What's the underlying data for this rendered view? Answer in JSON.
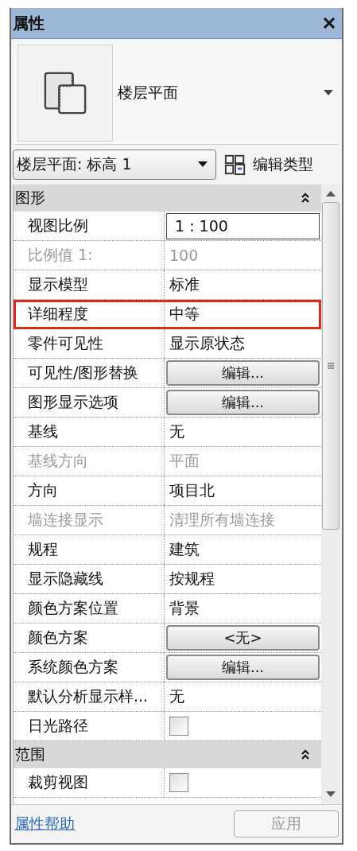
{
  "panel": {
    "title": "属性"
  },
  "type_selector": {
    "type_name": "楼层平面"
  },
  "instance_selector": {
    "value": "楼层平面: 标高 1"
  },
  "edit_type_button": {
    "label": "编辑类型"
  },
  "sections": [
    {
      "title": "图形",
      "expanded": true,
      "rows": [
        {
          "label": "视图比例",
          "kind": "input",
          "value": "1 : 100",
          "disabled": false,
          "highlighted": false
        },
        {
          "label": "比例值 1:",
          "kind": "text",
          "value": "100",
          "disabled": true,
          "highlighted": false
        },
        {
          "label": "显示模型",
          "kind": "text",
          "value": "标准",
          "disabled": false,
          "highlighted": false
        },
        {
          "label": "详细程度",
          "kind": "text",
          "value": "中等",
          "disabled": false,
          "highlighted": true
        },
        {
          "label": "零件可见性",
          "kind": "text",
          "value": "显示原状态",
          "disabled": false,
          "highlighted": false
        },
        {
          "label": "可见性/图形替换",
          "kind": "button",
          "value": "编辑...",
          "disabled": false,
          "highlighted": false
        },
        {
          "label": "图形显示选项",
          "kind": "button",
          "value": "编辑...",
          "disabled": false,
          "highlighted": false
        },
        {
          "label": "基线",
          "kind": "text",
          "value": "无",
          "disabled": false,
          "highlighted": false
        },
        {
          "label": "基线方向",
          "kind": "text",
          "value": "平面",
          "disabled": true,
          "highlighted": false
        },
        {
          "label": "方向",
          "kind": "text",
          "value": "项目北",
          "disabled": false,
          "highlighted": false
        },
        {
          "label": "墙连接显示",
          "kind": "text",
          "value": "清理所有墙连接",
          "disabled": true,
          "highlighted": false
        },
        {
          "label": "规程",
          "kind": "text",
          "value": "建筑",
          "disabled": false,
          "highlighted": false
        },
        {
          "label": "显示隐藏线",
          "kind": "text",
          "value": "按规程",
          "disabled": false,
          "highlighted": false
        },
        {
          "label": "颜色方案位置",
          "kind": "text",
          "value": "背景",
          "disabled": false,
          "highlighted": false
        },
        {
          "label": "颜色方案",
          "kind": "button",
          "value": "<无>",
          "disabled": false,
          "highlighted": false
        },
        {
          "label": "系统颜色方案",
          "kind": "button",
          "value": "编辑...",
          "disabled": false,
          "highlighted": false
        },
        {
          "label": "默认分析显示样...",
          "kind": "text",
          "value": "无",
          "disabled": false,
          "highlighted": false
        },
        {
          "label": "日光路径",
          "kind": "checkbox",
          "checked": false,
          "disabled": false,
          "highlighted": false
        }
      ]
    },
    {
      "title": "范围",
      "expanded": true,
      "rows": [
        {
          "label": "裁剪视图",
          "kind": "checkbox",
          "checked": false,
          "disabled": false,
          "highlighted": false
        }
      ]
    }
  ],
  "help_link": "属性帮助",
  "apply_button": {
    "label": "应用",
    "disabled": true
  }
}
